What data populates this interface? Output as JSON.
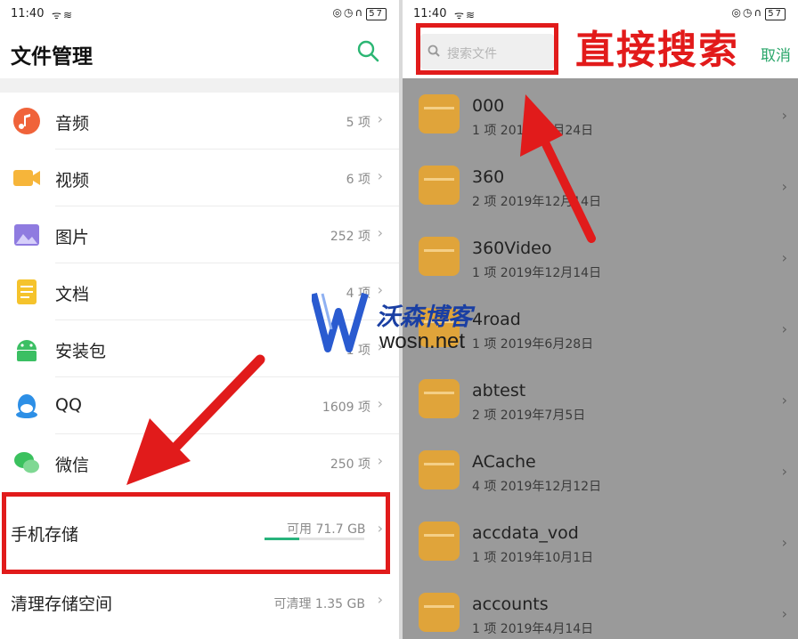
{
  "status": {
    "time": "11:40",
    "signal": "ᯤ≋",
    "icons": "◎◷∩",
    "battery": "57"
  },
  "left": {
    "title": "文件管理",
    "categories": [
      {
        "label": "音频",
        "count": "5 项",
        "icon": "music-icon",
        "color": "#f0633a"
      },
      {
        "label": "视频",
        "count": "6 项",
        "icon": "video-icon",
        "color": "#f6b53a"
      },
      {
        "label": "图片",
        "count": "252 项",
        "icon": "image-icon",
        "color": "#8f7be0"
      },
      {
        "label": "文档",
        "count": "4 项",
        "icon": "document-icon",
        "color": "#f5c32c"
      },
      {
        "label": "安装包",
        "count": "1 项",
        "icon": "android-icon",
        "color": "#3bbf63"
      },
      {
        "label": "QQ",
        "count": "1609 项",
        "icon": "qq-icon",
        "color": "#2d8fe6"
      },
      {
        "label": "微信",
        "count": "250 项",
        "icon": "wechat-icon",
        "color": "#3bc15e"
      }
    ],
    "storage": {
      "label": "手机存储",
      "free": "可用 71.7 GB",
      "used_fraction": 0.35
    },
    "clean": {
      "label": "清理存储空间",
      "value": "可清理 1.35 GB"
    },
    "chevron": "›"
  },
  "right": {
    "search_placeholder": "搜索文件",
    "annotation": "直接搜索",
    "cancel": "取消",
    "files": [
      {
        "name": "000",
        "meta": "1 项  2019年8月24日"
      },
      {
        "name": "360",
        "meta": "2 项  2019年12月14日"
      },
      {
        "name": "360Video",
        "meta": "1 项  2019年12月14日"
      },
      {
        "name": "4road",
        "meta": "1 项  2019年6月28日"
      },
      {
        "name": "abtest",
        "meta": "2 项  2019年7月5日"
      },
      {
        "name": "ACache",
        "meta": "4 项  2019年12月12日"
      },
      {
        "name": "accdata_vod",
        "meta": "1 项  2019年10月1日"
      },
      {
        "name": "accounts",
        "meta": "1 项  2019年4月14日"
      }
    ],
    "chevron": "›"
  },
  "watermark": {
    "title": "沃森博客",
    "url": "wosn.net"
  },
  "colors": {
    "accent_green": "#28b37c",
    "annotation_red": "#e11b1b",
    "folder": "#e0a43a"
  }
}
